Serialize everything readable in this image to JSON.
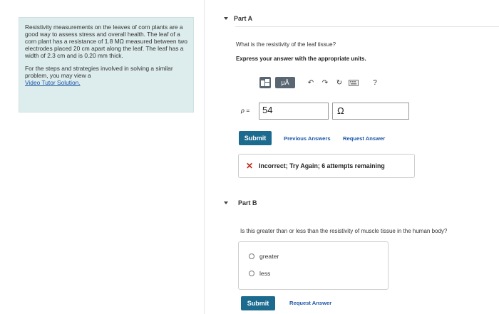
{
  "info": {
    "paragraph1": "Resistivity measurements on the leaves of corn plants are a good way to assess stress and overall health. The leaf of a corn plant has a resistance of 1.8 MΩ measured between two electrodes placed 20 cm apart along the leaf. The leaf has a width of 2.3 cm and is 0.20 mm thick.",
    "paragraph2": "For the steps and strategies involved in solving a similar problem, you may view a",
    "link": "Video Tutor Solution."
  },
  "partA": {
    "title": "Part A",
    "question": "What is the resistivity of the leaf tissue?",
    "instruction": "Express your answer with the appropriate units.",
    "toolbar": {
      "templates_icon": "templates-icon",
      "micro_label": "μÅ",
      "undo": "↶",
      "redo": "↷",
      "reset": "↻",
      "keyboard_icon": "keyboard-icon",
      "help": "?"
    },
    "variable": "ρ =",
    "value": "54",
    "unit": "Ω",
    "submit": "Submit",
    "previous_answers": "Previous Answers",
    "request_answer": "Request Answer",
    "feedback": "Incorrect; Try Again; 6 attempts remaining",
    "feedback_icon": "✕"
  },
  "partB": {
    "title": "Part B",
    "question": "Is this greater than or less than the resistivity of muscle tissue in the human body?",
    "options": [
      "greater",
      "less"
    ],
    "submit": "Submit",
    "request_answer": "Request Answer"
  }
}
